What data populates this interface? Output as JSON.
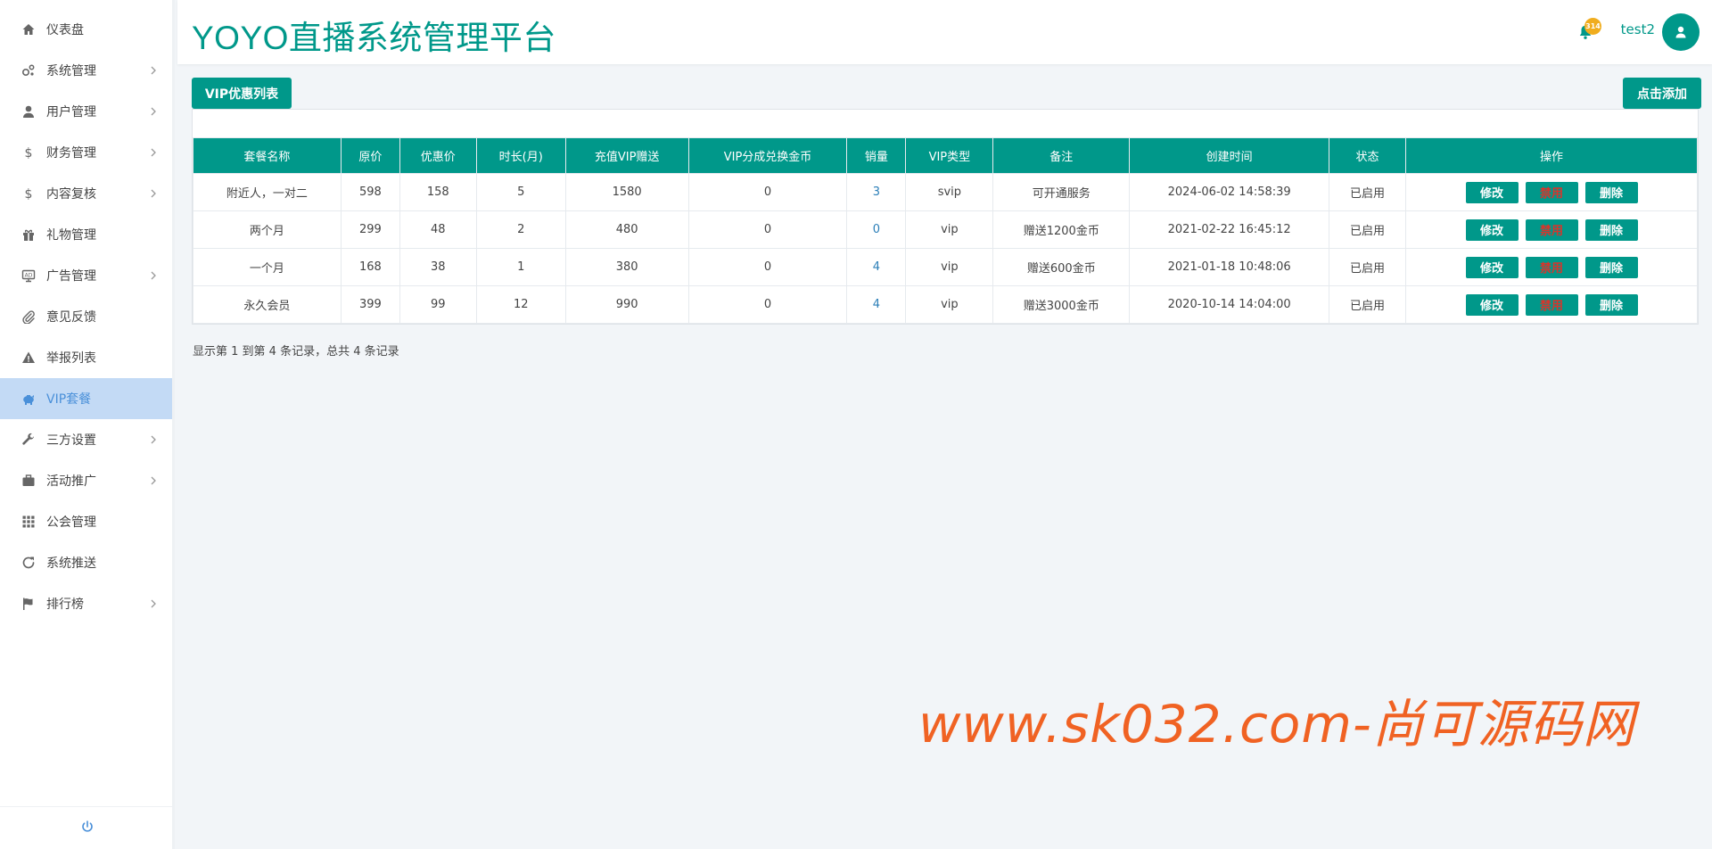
{
  "sidebar": {
    "items": [
      {
        "label": "仪表盘",
        "icon": "home-icon",
        "has_children": false
      },
      {
        "label": "系统管理",
        "icon": "cogs-icon",
        "has_children": true
      },
      {
        "label": "用户管理",
        "icon": "user-icon",
        "has_children": true
      },
      {
        "label": "财务管理",
        "icon": "dollar-icon",
        "has_children": true
      },
      {
        "label": "内容复核",
        "icon": "dollar-icon",
        "has_children": true
      },
      {
        "label": "礼物管理",
        "icon": "gift-icon",
        "has_children": false
      },
      {
        "label": "广告管理",
        "icon": "ad-icon",
        "has_children": true
      },
      {
        "label": "意见反馈",
        "icon": "paperclip-icon",
        "has_children": false
      },
      {
        "label": "举报列表",
        "icon": "warning-icon",
        "has_children": false
      },
      {
        "label": "VIP套餐",
        "icon": "piggy-bank-icon",
        "has_children": false,
        "active": true
      },
      {
        "label": "三方设置",
        "icon": "wrench-icon",
        "has_children": true
      },
      {
        "label": "活动推广",
        "icon": "briefcase-icon",
        "has_children": true
      },
      {
        "label": "公会管理",
        "icon": "grid-icon",
        "has_children": false
      },
      {
        "label": "系统推送",
        "icon": "refresh-icon",
        "has_children": false
      },
      {
        "label": "排行榜",
        "icon": "flag-icon",
        "has_children": true
      }
    ],
    "footer_icon": "power-icon"
  },
  "header": {
    "title": "YOYO直播系统管理平台",
    "badge": "314",
    "username": "test2"
  },
  "toolbar": {
    "tab_label": "VIP优惠列表",
    "add_label": "点击添加"
  },
  "table": {
    "columns": [
      "套餐名称",
      "原价",
      "优惠价",
      "时长(月)",
      "充值VIP赠送",
      "VIP分成兑换金币",
      "销量",
      "VIP类型",
      "备注",
      "创建时间",
      "状态",
      "操作"
    ],
    "rows": [
      [
        "附近人，一对二",
        "598",
        "158",
        "5",
        "1580",
        "0",
        "3",
        "svip",
        "可开通服务",
        "2024-06-02 14:58:39",
        "已启用"
      ],
      [
        "两个月",
        "299",
        "48",
        "2",
        "480",
        "0",
        "0",
        "vip",
        "赠送1200金币",
        "2021-02-22 16:45:12",
        "已启用"
      ],
      [
        "一个月",
        "168",
        "38",
        "1",
        "380",
        "0",
        "4",
        "vip",
        "赠送600金币",
        "2021-01-18 10:48:06",
        "已启用"
      ],
      [
        "永久会员",
        "399",
        "99",
        "12",
        "990",
        "0",
        "4",
        "vip",
        "赠送3000金币",
        "2020-10-14 14:04:00",
        "已启用"
      ]
    ],
    "actions": {
      "edit": "修改",
      "disable": "禁用",
      "delete": "删除"
    }
  },
  "summary": "显示第 1 到第 4 条记录，总共 4 条记录",
  "watermark": "www.sk032.com-尚可源码网",
  "colors": {
    "primary": "#00988a",
    "active_bg": "#c3daf5",
    "danger_text": "#d9342b",
    "watermark": "#f06223"
  }
}
